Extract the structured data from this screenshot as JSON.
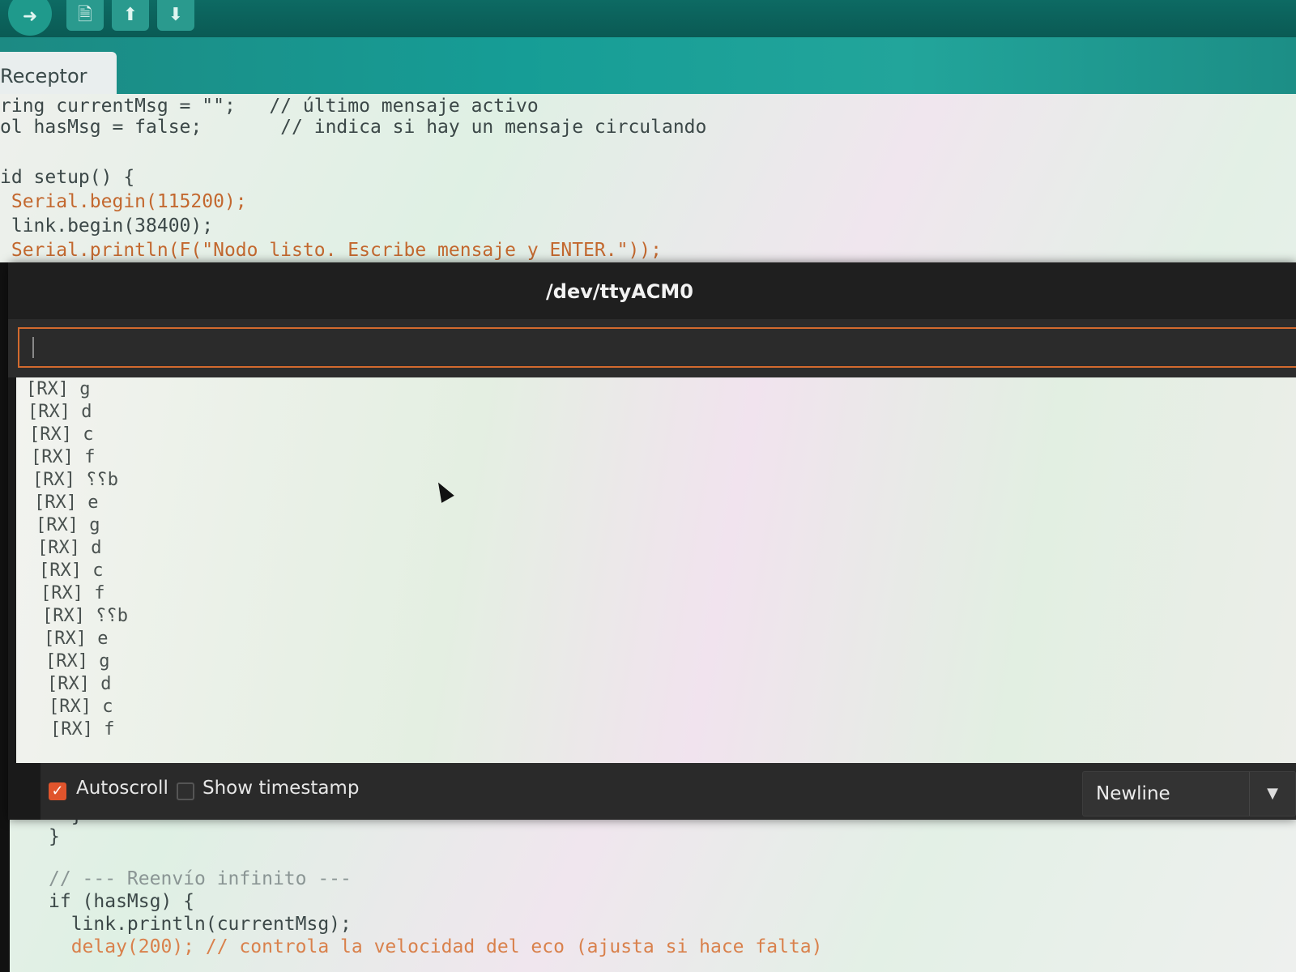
{
  "toolbar": {
    "buttons": [
      {
        "icon": "arrow-right-icon",
        "glyph": "➜"
      },
      {
        "icon": "new-file-icon",
        "glyph": "🗎"
      },
      {
        "icon": "upload-icon",
        "glyph": "⬆"
      },
      {
        "icon": "download-icon",
        "glyph": "⬇"
      }
    ]
  },
  "tab": {
    "label": "Receptor"
  },
  "code_top": [
    "ring currentMsg = \"\";   // último mensaje activo",
    "ol hasMsg = false;       // indica si hay un mensaje circulando",
    "",
    "id setup() {",
    " Serial.begin(115200);",
    " link.begin(38400);",
    " Serial.println(F(\"Nodo listo. Escribe mensaje y ENTER.\"));"
  ],
  "monitor": {
    "title": "/dev/ttyACM0",
    "input_value": "",
    "output_lines": [
      "[RX] g",
      "[RX] d",
      "[RX] c",
      "[RX] f",
      "[RX] ⸮⸮b",
      "[RX] e",
      "[RX] g",
      "[RX] d",
      "[RX] c",
      "[RX] f",
      "[RX] ⸮⸮b",
      "[RX] e",
      "[RX] g",
      "[RX] d",
      "[RX] c",
      "[RX] f"
    ],
    "autoscroll": {
      "label": "Autoscroll",
      "checked": true
    },
    "timestamp": {
      "label": "Show timestamp",
      "checked": false
    },
    "line_ending": {
      "value": "Newline"
    }
  },
  "code_bottom": [
    "  }",
    "}",
    "",
    "// --- Reenvío infinito ---",
    "if (hasMsg) {",
    "  link.println(currentMsg);",
    "  delay(200); // controla la velocidad del eco (ajusta si hace falta)"
  ],
  "colors": {
    "accent": "#e0542c",
    "toolbar": "#0d6a63",
    "tabbar": "#169d96"
  }
}
